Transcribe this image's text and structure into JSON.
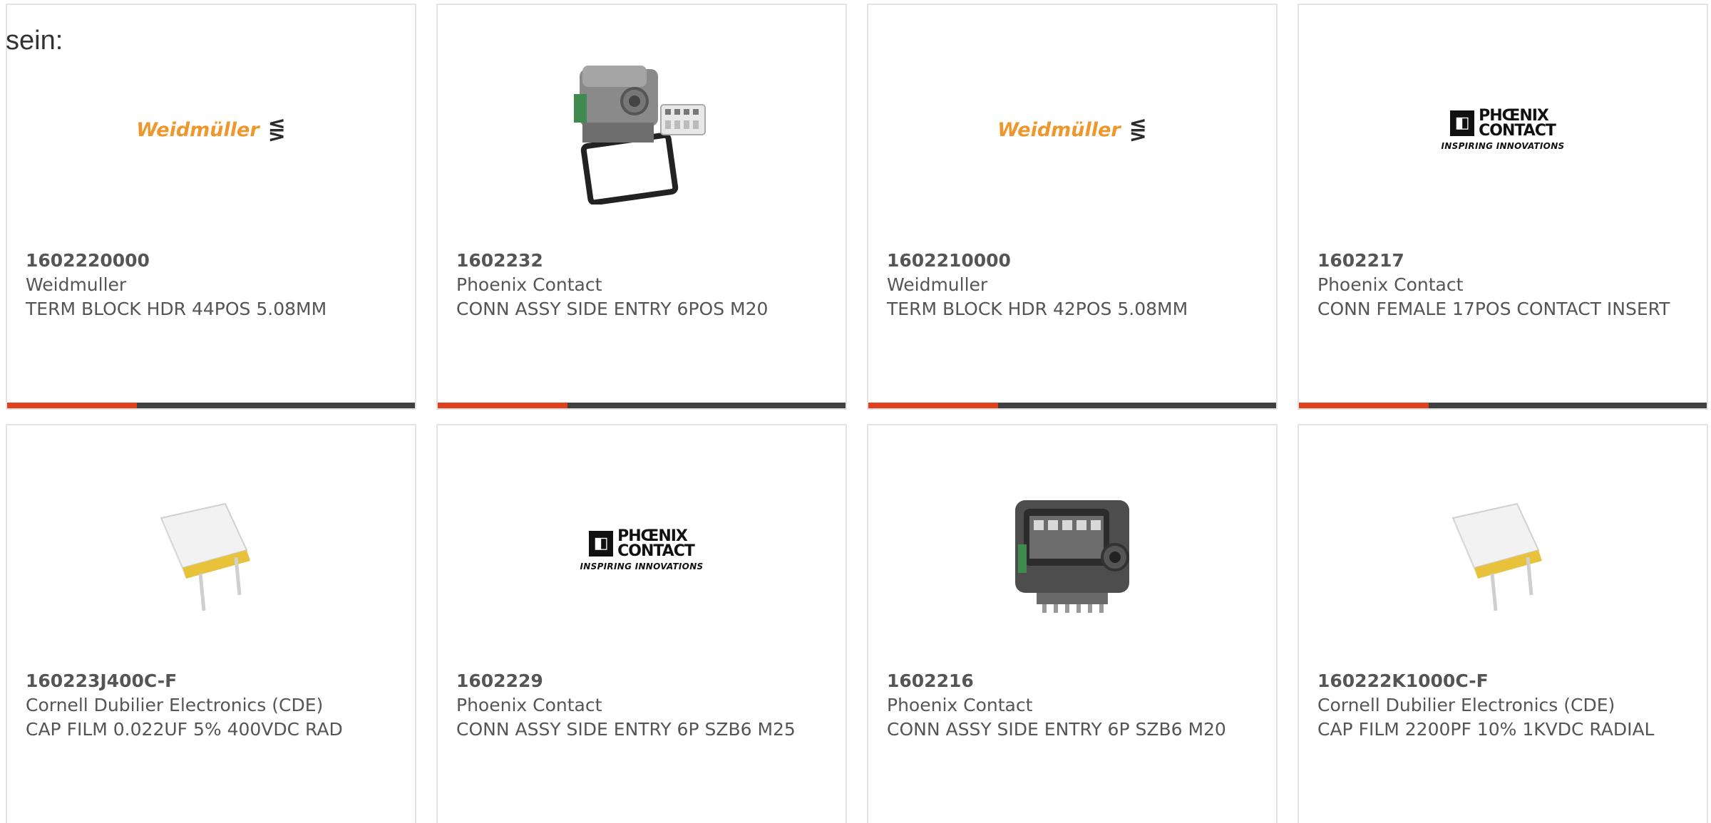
{
  "intro_text": "sein:",
  "brand_logos": {
    "weidmuller": "Weidmüller",
    "weidmuller_symbol": "⋚",
    "phoenix_line1": "PHŒNIX",
    "phoenix_line2": "CONTACT",
    "phoenix_tagline": "INSPIRING INNOVATIONS"
  },
  "colors": {
    "accent": "#e0401b",
    "bar": "#404040",
    "weidmuller_orange": "#f0972c"
  },
  "products": [
    {
      "part_number": "1602220000",
      "manufacturer": "Weidmuller",
      "description": "TERM BLOCK HDR 44POS 5.08MM",
      "image": "weidmuller-logo"
    },
    {
      "part_number": "1602232",
      "manufacturer": "Phoenix Contact",
      "description": "CONN ASSY SIDE ENTRY 6POS M20",
      "image": "connector-housing-photo"
    },
    {
      "part_number": "1602210000",
      "manufacturer": "Weidmuller",
      "description": "TERM BLOCK HDR 42POS 5.08MM",
      "image": "weidmuller-logo"
    },
    {
      "part_number": "1602217",
      "manufacturer": "Phoenix Contact",
      "description": "CONN FEMALE 17POS CONTACT INSERT",
      "image": "phoenix-contact-logo"
    },
    {
      "part_number": "160223J400C-F",
      "manufacturer": "Cornell Dubilier Electronics (CDE)",
      "description": "CAP FILM 0.022UF 5% 400VDC RAD",
      "image": "film-capacitor-photo"
    },
    {
      "part_number": "1602229",
      "manufacturer": "Phoenix Contact",
      "description": "CONN ASSY SIDE ENTRY 6P SZB6 M25",
      "image": "phoenix-contact-logo"
    },
    {
      "part_number": "1602216",
      "manufacturer": "Phoenix Contact",
      "description": "CONN ASSY SIDE ENTRY 6P SZB6 M20",
      "image": "connector-housing-photo"
    },
    {
      "part_number": "160222K1000C-F",
      "manufacturer": "Cornell Dubilier Electronics (CDE)",
      "description": "CAP FILM 2200PF 10% 1KVDC RADIAL",
      "image": "film-capacitor-photo"
    }
  ]
}
